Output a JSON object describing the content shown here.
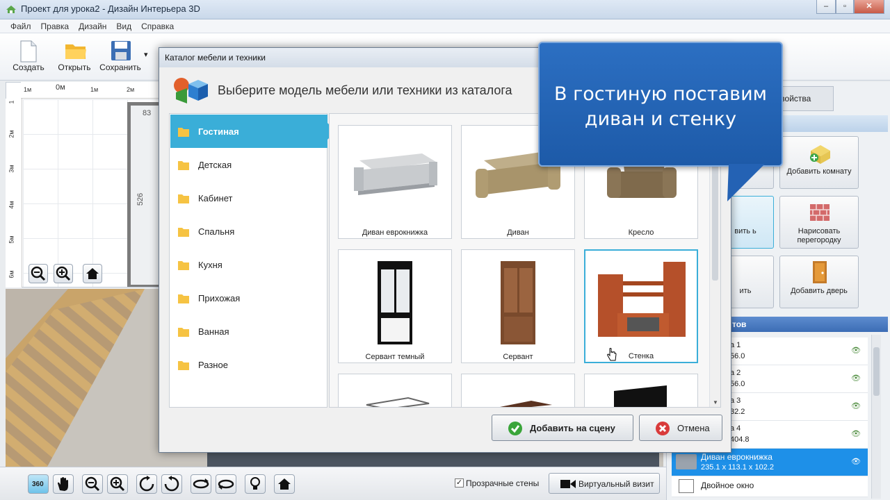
{
  "window": {
    "title": "Проект для урока2 - Дизайн Интерьера 3D",
    "controls": [
      "‒",
      "▫",
      "✕"
    ]
  },
  "menu": [
    "Файл",
    "Правка",
    "Дизайн",
    "Вид",
    "Справка"
  ],
  "toolbar": {
    "create": "Создать",
    "open": "Открыть",
    "save": "Сохранить",
    "more": "▾"
  },
  "ruler": {
    "top": [
      "1м",
      "0м",
      "1м",
      "2м"
    ],
    "left": [
      "1",
      "2м",
      "3м",
      "4м",
      "5м",
      "6м"
    ]
  },
  "plan": {
    "dim_top": "83",
    "dim_side": "526"
  },
  "bottom": {
    "transparent_walls": "Прозрачные стены",
    "virtual_visit": "Виртуальный визит",
    "rotate360": "360"
  },
  "right_panel": {
    "properties_tab": "Свойства",
    "objects_header": "тов",
    "buttons": [
      {
        "label": "Добавить комнату"
      },
      {
        "label": "Нарисовать перегородку"
      },
      {
        "label": "Добавить дверь"
      }
    ],
    "partial_buttons": [
      "ить",
      "вить\nь",
      "ить"
    ],
    "objects": [
      {
        "name": "а 1",
        "size": "56.0"
      },
      {
        "name": "а 2",
        "size": "56.0"
      },
      {
        "name": "а 3",
        "size": "32.2"
      },
      {
        "name": "а 4",
        "size": "404.8"
      },
      {
        "name": "Диван еврокнижка",
        "size": "235.1 x 113.1 x 102.2",
        "selected": true
      },
      {
        "name": "Двойное окно",
        "size": ""
      }
    ]
  },
  "dialog": {
    "title": "Каталог мебели и техники",
    "close": "✕",
    "heading": "Выберите модель мебели или техники из каталога",
    "categories": [
      "Гостиная",
      "Детская",
      "Кабинет",
      "Спальня",
      "Кухня",
      "Прихожая",
      "Ванная",
      "Разное"
    ],
    "selected_category": "Гостиная",
    "items": [
      "Диван еврокнижка",
      "Диван",
      "Кресло",
      "Сервант темный",
      "Сервант",
      "Стенка",
      "",
      "",
      ""
    ],
    "selected_item": "Стенка",
    "add_button": "Добавить на сцену",
    "cancel_button": "Отмена"
  },
  "callout": {
    "line1": "В гостиную поставим",
    "line2": "диван и стенку"
  },
  "colors": {
    "accent": "#3aaed8",
    "callout": "#2565b8",
    "selected_row": "#1e90e8"
  }
}
